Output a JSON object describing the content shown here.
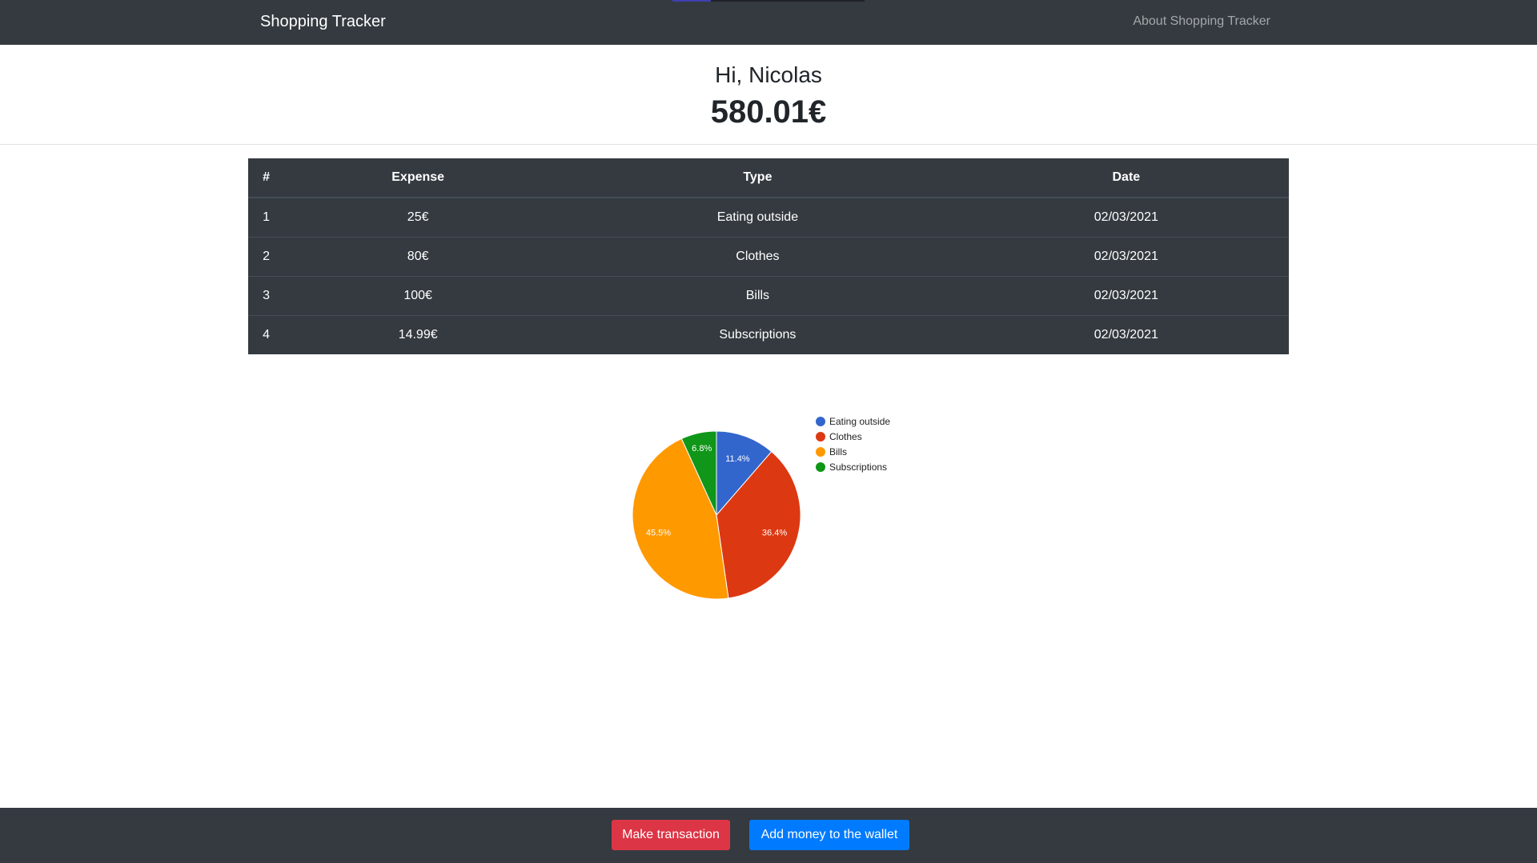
{
  "navbar": {
    "brand": "Shopping Tracker",
    "about_link": "About Shopping Tracker"
  },
  "header": {
    "greeting": "Hi, Nicolas",
    "balance": "580.01€"
  },
  "table": {
    "columns": [
      "#",
      "Expense",
      "Type",
      "Date"
    ],
    "rows": [
      [
        "1",
        "25€",
        "Eating outside",
        "02/03/2021"
      ],
      [
        "2",
        "80€",
        "Clothes",
        "02/03/2021"
      ],
      [
        "3",
        "100€",
        "Bills",
        "02/03/2021"
      ],
      [
        "4",
        "14.99€",
        "Subscriptions",
        "02/03/2021"
      ]
    ]
  },
  "chart_data": {
    "type": "pie",
    "categories": [
      "Eating outside",
      "Clothes",
      "Bills",
      "Subscriptions"
    ],
    "values": [
      25,
      80,
      100,
      14.99
    ],
    "labels": [
      "11.4%",
      "36.4%",
      "45.5%",
      "6.8%"
    ],
    "colors": [
      "#3366cc",
      "#dc3912",
      "#ff9900",
      "#109618"
    ],
    "legend": "right"
  },
  "footer": {
    "make_transaction": "Make transaction",
    "add_money": "Add money to the wallet"
  }
}
